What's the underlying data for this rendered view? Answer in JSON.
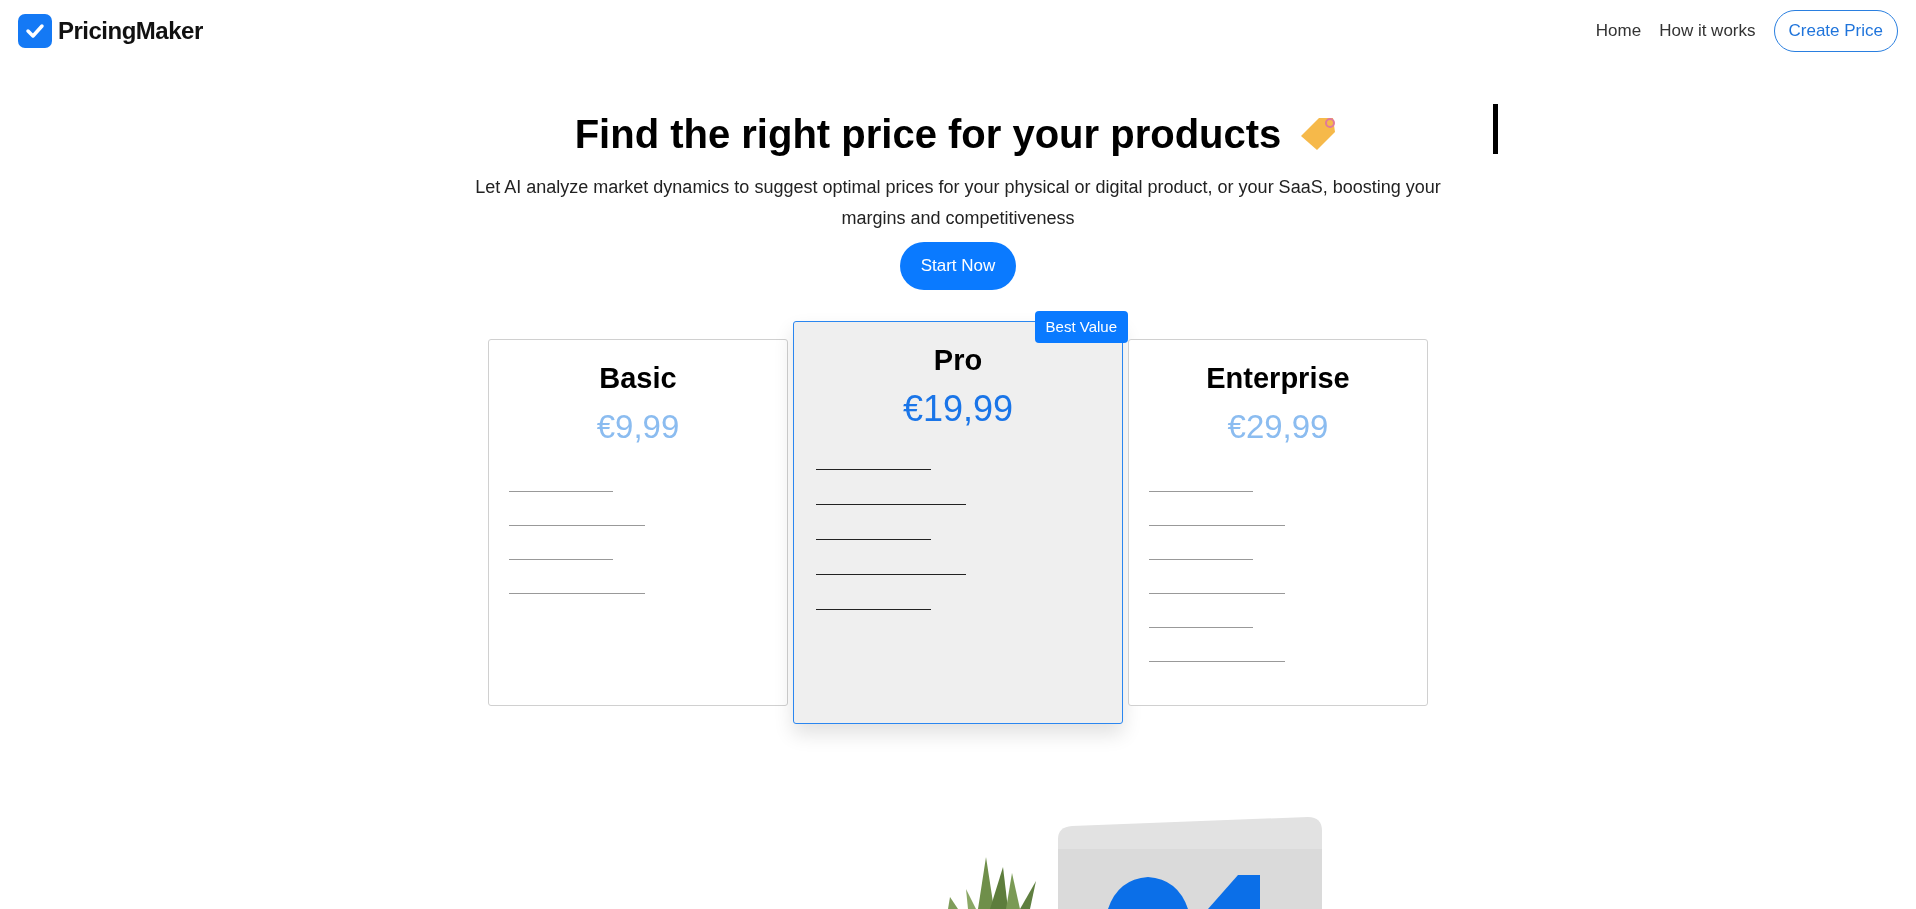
{
  "header": {
    "brand": "PricingMaker",
    "nav": [
      {
        "label": "Home",
        "kind": "link"
      },
      {
        "label": "How it works",
        "kind": "link"
      },
      {
        "label": "Create Price",
        "kind": "outline"
      }
    ]
  },
  "hero": {
    "title": "Find the right price for your products",
    "subtitle": "Let AI analyze market dynamics to suggest optimal prices for your physical or digital product, or your SaaS, boosting your margins and competitiveness",
    "button": "Start Now"
  },
  "plans": [
    {
      "name": "Basic",
      "price": "€9,99",
      "featured": false,
      "features": [
        {
          "kind": "short"
        },
        {
          "kind": "long"
        },
        {
          "kind": "short"
        },
        {
          "kind": "long"
        }
      ]
    },
    {
      "name": "Pro",
      "price": "€19,99",
      "featured": true,
      "badge": "Best Value",
      "features": [
        {
          "kind": "short"
        },
        {
          "kind": "long"
        },
        {
          "kind": "short"
        },
        {
          "kind": "long"
        },
        {
          "kind": "short"
        }
      ]
    },
    {
      "name": "Enterprise",
      "price": "€29,99",
      "featured": false,
      "features": [
        {
          "kind": "short"
        },
        {
          "kind": "long"
        },
        {
          "kind": "short"
        },
        {
          "kind": "long"
        },
        {
          "kind": "short"
        },
        {
          "kind": "long"
        }
      ]
    }
  ]
}
